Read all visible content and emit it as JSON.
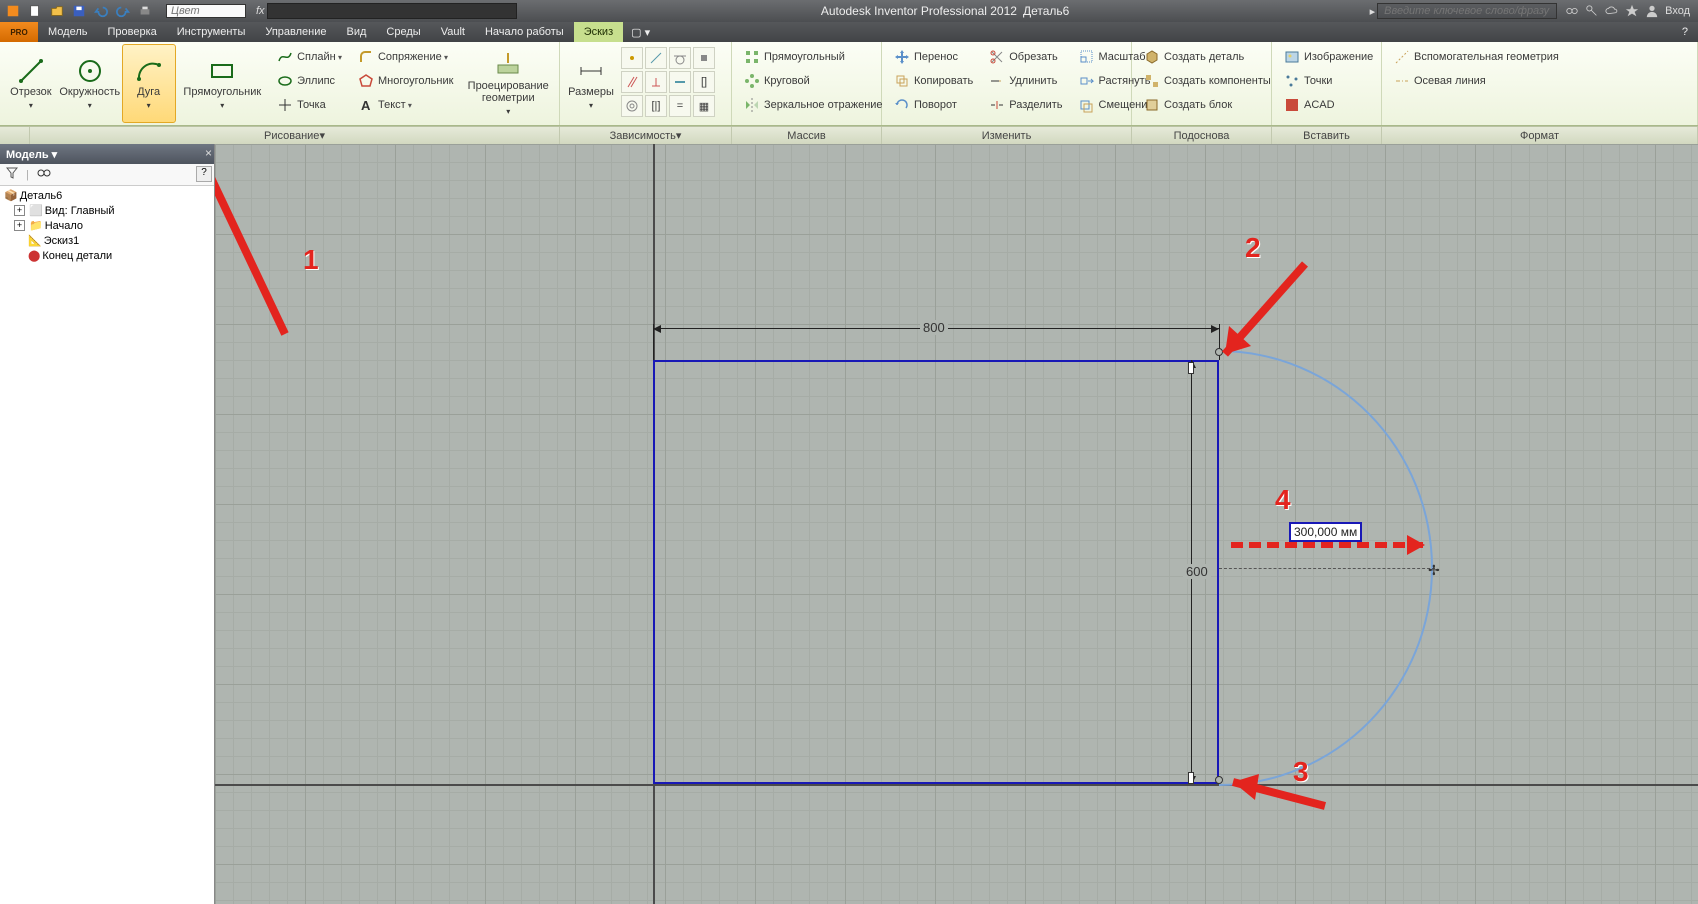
{
  "titlebar": {
    "color_placeholder": "Цвет",
    "fx_label": "fx",
    "app_title": "Autodesk Inventor Professional 2012",
    "doc_title": "Деталь6",
    "search_placeholder": "Введите ключевое слово/фразу",
    "signin": "Вход"
  },
  "menutabs": {
    "pro": "PRO",
    "items": [
      "Модель",
      "Проверка",
      "Инструменты",
      "Управление",
      "Вид",
      "Среды",
      "Vault",
      "Начало работы",
      "Эскиз"
    ],
    "active": "Эскиз"
  },
  "ribbon": {
    "draw": {
      "line": "Отрезок",
      "circle": "Окружность",
      "arc": "Дуга",
      "rect": "Прямоугольник",
      "spline": "Сплайн",
      "ellipse": "Эллипс",
      "point": "Точка",
      "fillet": "Сопряжение",
      "polygon": "Многоугольник",
      "text": "Текст",
      "project": "Проецирование геометрии",
      "title": "Рисование"
    },
    "dims": {
      "label": "Размеры",
      "title": "Зависимость"
    },
    "array": {
      "rect": "Прямоугольный",
      "circ": "Круговой",
      "mirror": "Зеркальное отражение",
      "title": "Массив"
    },
    "modify": {
      "move": "Перенос",
      "copy": "Копировать",
      "rotate": "Поворот",
      "trim": "Обрезать",
      "extend": "Удлинить",
      "split": "Разделить",
      "scale": "Масштаб",
      "stretch": "Растянуть",
      "offset": "Смещение",
      "title": "Изменить"
    },
    "layout": {
      "makepart": "Создать деталь",
      "makecomp": "Создать компоненты",
      "makeblock": "Создать блок",
      "title": "Подоснова"
    },
    "insert": {
      "image": "Изображение",
      "points": "Точки",
      "acad": "ACAD",
      "title": "Вставить"
    },
    "format": {
      "construct": "Вспомогательная геометрия",
      "centerline": "Осевая линия",
      "title": "Формат"
    }
  },
  "browser": {
    "title": "Модель",
    "root": "Деталь6",
    "nodes": {
      "view": "Вид: Главный",
      "origin": "Начало",
      "sketch": "Эскиз1",
      "eop": "Конец детали"
    }
  },
  "canvas": {
    "dim_w": "800",
    "dim_h": "600",
    "input_val": "300,000 мм"
  },
  "annot": {
    "n1": "1",
    "n2": "2",
    "n3": "3",
    "n4": "4"
  }
}
